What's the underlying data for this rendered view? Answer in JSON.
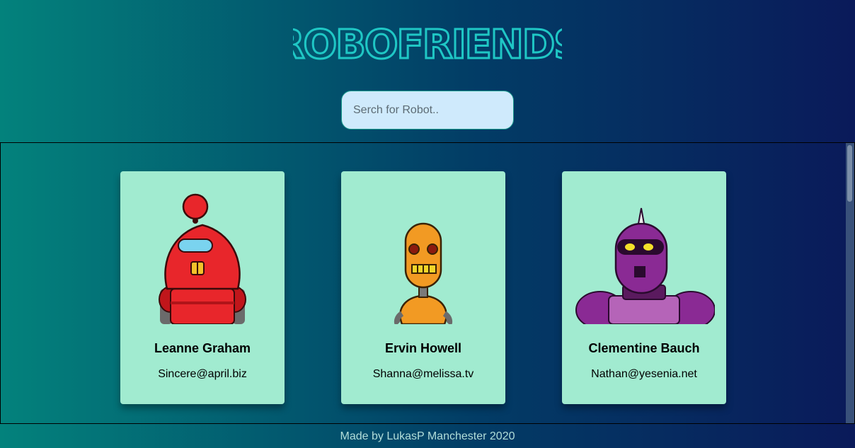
{
  "header": {
    "title": "ROBOFRIENDS",
    "title_color": "#1fc7c5"
  },
  "search": {
    "placeholder": "Serch for Robot.."
  },
  "robots": [
    {
      "name": "Leanne Graham",
      "email": "Sincere@april.biz",
      "avatar_color": "#e8262b"
    },
    {
      "name": "Ervin Howell",
      "email": "Shanna@melissa.tv",
      "avatar_color": "#f29a23"
    },
    {
      "name": "Clementine Bauch",
      "email": "Nathan@yesenia.net",
      "avatar_color": "#8a2a94"
    }
  ],
  "footer": {
    "text": "Made by LukasP Manchester 2020"
  },
  "colors": {
    "card_background": "#a1ebd0",
    "search_background": "#cfeafc"
  }
}
